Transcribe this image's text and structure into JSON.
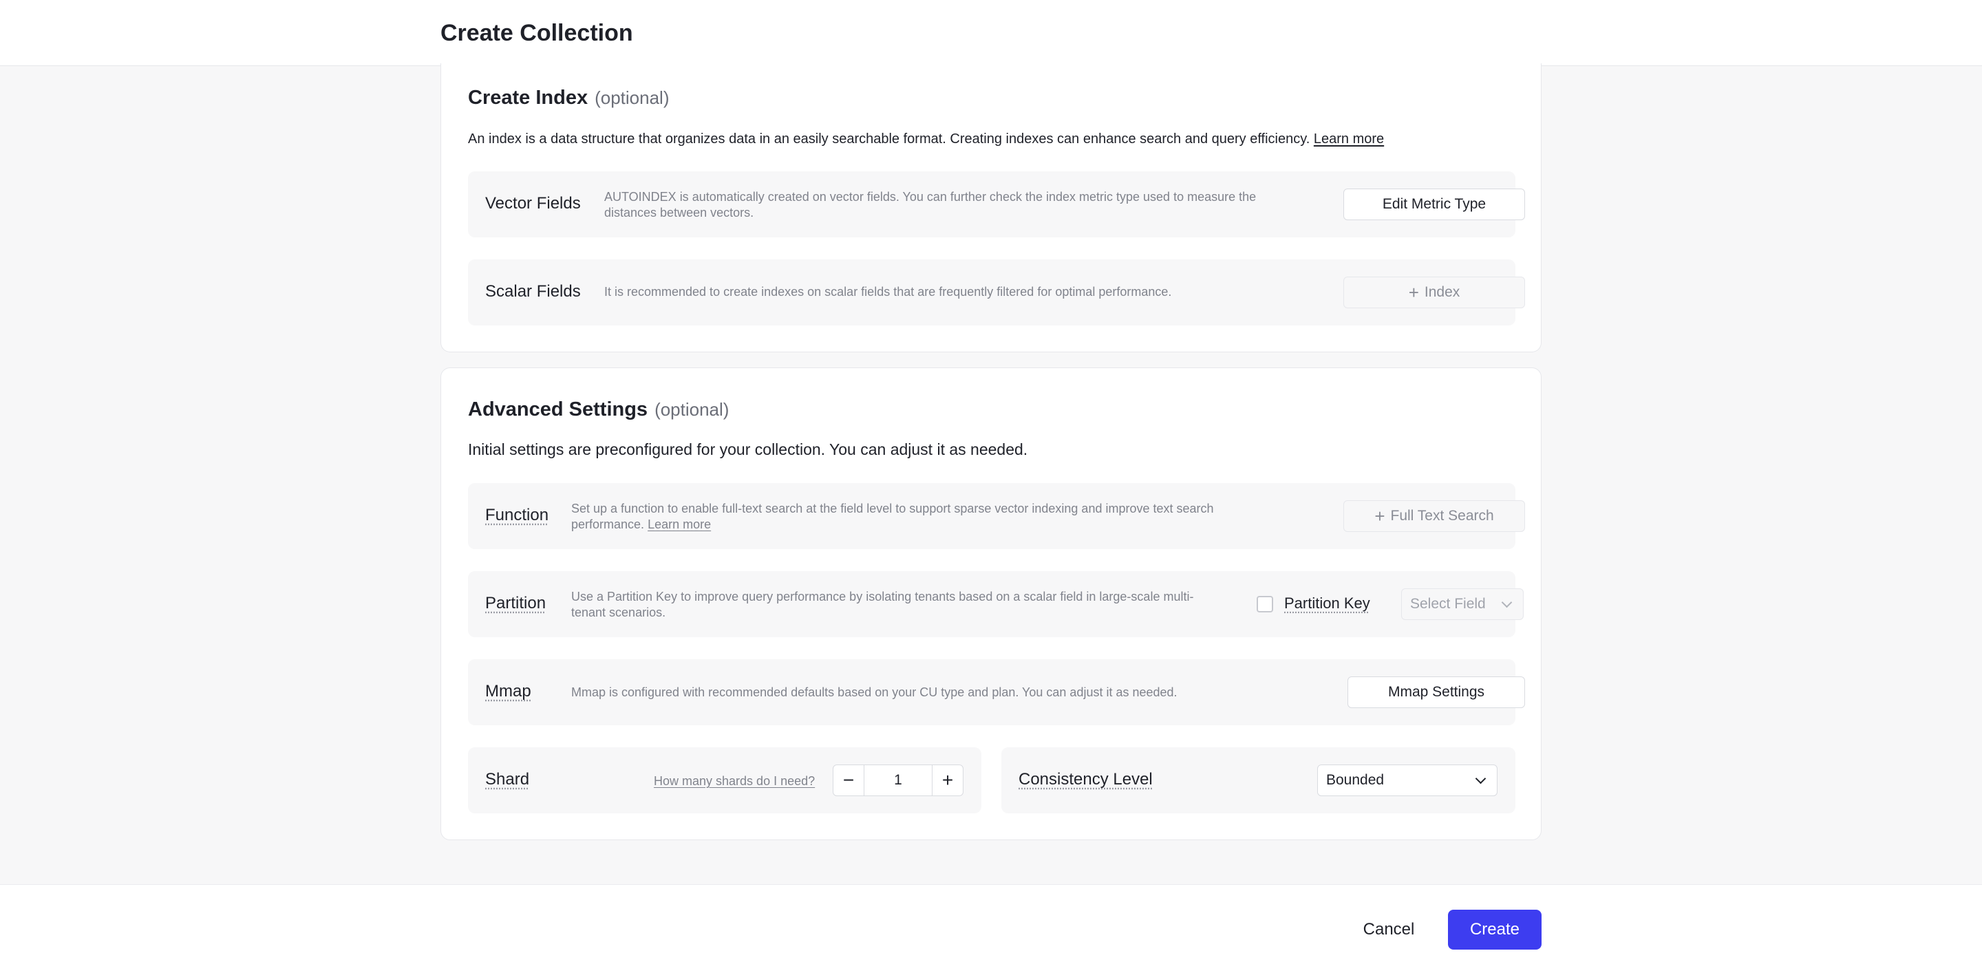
{
  "header": {
    "title": "Create Collection"
  },
  "index_section": {
    "title": "Create Index",
    "optional": "(optional)",
    "description": "An index is a data structure that organizes data in an easily searchable format. Creating indexes can enhance search and query efficiency.",
    "learn_more": "Learn more",
    "vector_fields": {
      "label": "Vector Fields",
      "description": "AUTOINDEX is automatically created on vector fields. You can further check the index metric type used to measure the distances between vectors.",
      "button": "Edit Metric Type"
    },
    "scalar_fields": {
      "label": "Scalar Fields",
      "description": "It is recommended to create indexes on scalar fields that are frequently filtered for optimal performance.",
      "button": "Index"
    }
  },
  "advanced_section": {
    "title": "Advanced Settings",
    "optional": "(optional)",
    "description": "Initial settings are preconfigured for your collection. You can adjust it as needed.",
    "function": {
      "label": "Function",
      "description": "Set up a function to enable full-text search at the field level to support sparse vector indexing and improve text search performance.",
      "learn_more": "Learn more",
      "button": "Full Text Search"
    },
    "partition": {
      "label": "Partition",
      "description": "Use a Partition Key to improve query performance by isolating tenants based on a scalar field in large-scale multi-tenant scenarios.",
      "checkbox_label": "Partition Key",
      "select_placeholder": "Select Field"
    },
    "mmap": {
      "label": "Mmap",
      "description": "Mmap is configured with recommended defaults based on your CU type and plan. You can adjust it as needed.",
      "button": "Mmap Settings"
    },
    "shard": {
      "label": "Shard",
      "help_link": "How many shards do I need?",
      "value": "1",
      "minus": "−",
      "plus": "+"
    },
    "consistency": {
      "label": "Consistency Level",
      "value": "Bounded"
    }
  },
  "footer": {
    "cancel": "Cancel",
    "create": "Create"
  },
  "colors": {
    "primary": "#3d3df0",
    "background": "#f7f7f8",
    "card": "#ffffff"
  }
}
